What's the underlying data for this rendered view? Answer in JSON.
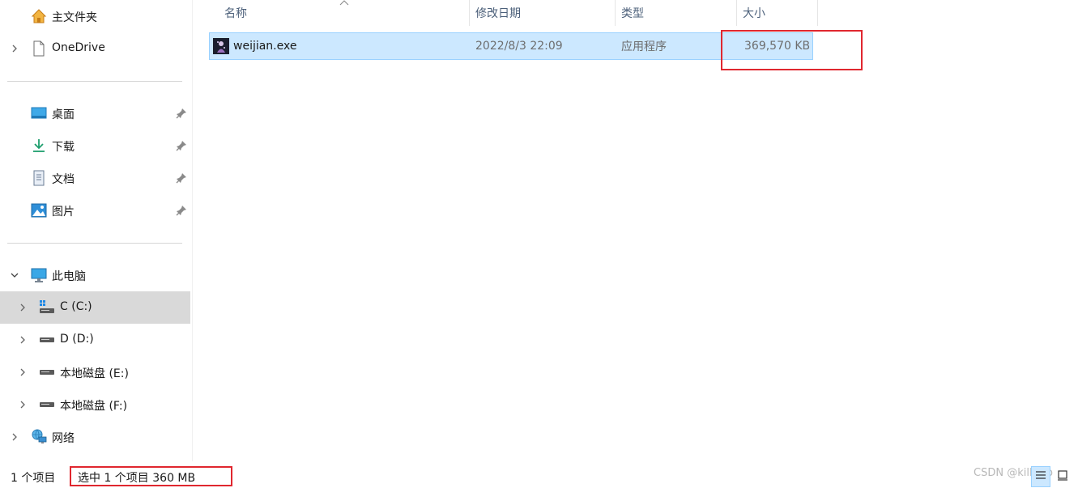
{
  "sidebar": {
    "items": [
      {
        "label": "主文件夹",
        "icon": "home-icon"
      },
      {
        "label": "OneDrive",
        "icon": "onedrive-file-icon"
      },
      {
        "label": "桌面",
        "icon": "desktop-icon"
      },
      {
        "label": "下载",
        "icon": "download-icon"
      },
      {
        "label": "文档",
        "icon": "document-icon"
      },
      {
        "label": "图片",
        "icon": "pictures-icon"
      },
      {
        "label": "此电脑",
        "icon": "computer-icon"
      },
      {
        "label": "C (C:)",
        "icon": "windows-drive-icon"
      },
      {
        "label": "D (D:)",
        "icon": "drive-icon"
      },
      {
        "label": "本地磁盘 (E:)",
        "icon": "drive-icon"
      },
      {
        "label": "本地磁盘 (F:)",
        "icon": "drive-icon"
      },
      {
        "label": "网络",
        "icon": "network-icon"
      }
    ]
  },
  "columns": {
    "name": "名称",
    "modified": "修改日期",
    "type": "类型",
    "size": "大小"
  },
  "files": [
    {
      "name": "weijian.exe",
      "modified": "2022/8/3 22:09",
      "type": "应用程序",
      "size": "369,570 KB"
    }
  ],
  "status": {
    "count": "1 个项目",
    "selection": "选中 1 个项目  360 MB"
  },
  "watermark": "CSDN @killer-p",
  "colors": {
    "selection_bg": "#cce8ff",
    "selection_border": "#99d1ff",
    "highlight_red": "#e0272f",
    "header_text": "#4c607a"
  }
}
